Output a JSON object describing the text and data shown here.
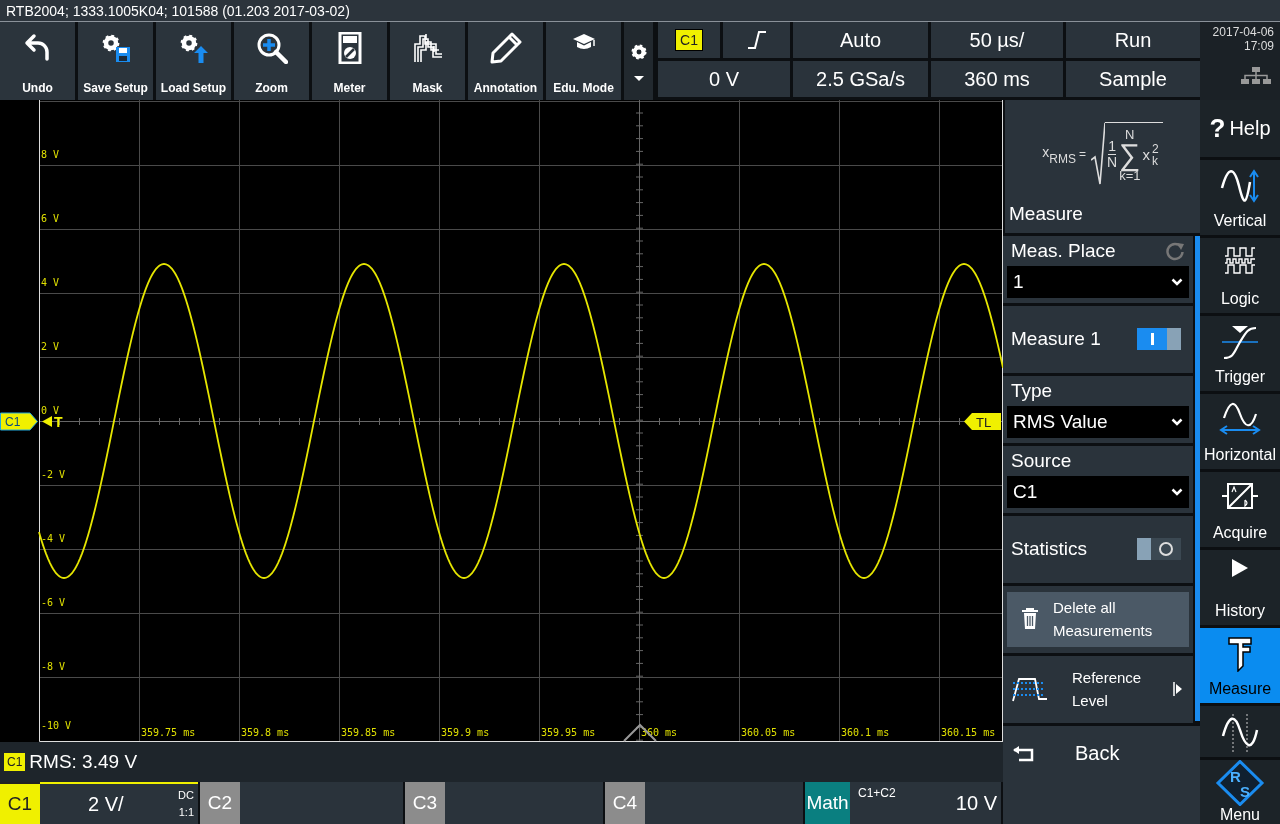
{
  "title_bar": {
    "text": "RTB2004; 1333.1005K04; 101588 (01.203 2017-03-02)"
  },
  "toolbar": {
    "buttons": [
      {
        "kind": "undo",
        "label": "Undo"
      },
      {
        "kind": "save",
        "label": "Save Setup"
      },
      {
        "kind": "load",
        "label": "Load Setup"
      },
      {
        "kind": "zoom",
        "label": "Zoom"
      },
      {
        "kind": "meter",
        "label": "Meter"
      },
      {
        "kind": "mask",
        "label": "Mask"
      },
      {
        "kind": "annotation",
        "label": "Annotation"
      },
      {
        "kind": "edu",
        "label": "Edu. Mode"
      }
    ]
  },
  "acquisition": {
    "trigger_source": "C1",
    "trigger_mode": "Auto",
    "time_scale": "50 µs/",
    "run_state": "Run",
    "trigger_level": "0 V",
    "sample_rate": "2.5 GSa/s",
    "time_position": "360 ms",
    "acquisition_mode": "Sample"
  },
  "clock": {
    "date": "2017-04-06",
    "time": "17:09"
  },
  "display": {
    "y_labels": [
      "8 V",
      "6 V",
      "4 V",
      "2 V",
      "0 V",
      "-2 V",
      "-4 V",
      "-6 V",
      "-8 V",
      "-10 V"
    ],
    "x_labels": [
      "359.75 ms",
      "359.8 ms",
      "359.85 ms",
      "359.9 ms",
      "359.95 ms",
      "360 ms",
      "360.05 ms",
      "360.1 ms",
      "360.15 ms"
    ],
    "channel_marker": "C1",
    "trigger_marker": "T",
    "trigger_level_marker": "TL"
  },
  "measurement_readout": {
    "source": "C1",
    "text": "RMS: 3.49 V"
  },
  "channel_bar": [
    {
      "kind": "channel",
      "label": "C1",
      "selected": true,
      "scale": "2 V/",
      "coupling": "DC",
      "probe": "1:1"
    },
    {
      "kind": "channel",
      "label": "C2",
      "selected": false
    },
    {
      "kind": "channel",
      "label": "C3",
      "selected": false
    },
    {
      "kind": "channel",
      "label": "C4",
      "selected": false
    },
    {
      "kind": "math",
      "label": "Math",
      "source": "C1+C2",
      "scale": "10 V"
    }
  ],
  "side_panel": {
    "formula": {
      "lhs": "x",
      "lhs_sub": "RMS",
      "equals": "=",
      "numerator": "1",
      "denominator": "N",
      "sum_top": "N",
      "sum_sign": "∑",
      "sum_bottom": "k=1",
      "term": "x",
      "term_sup": "2",
      "term_sub": "k"
    },
    "title": "Measure",
    "items": [
      {
        "kind": "dropdown",
        "label": "Meas. Place",
        "value": "1",
        "reset": true
      },
      {
        "kind": "toggle",
        "label": "Measure 1",
        "on": true
      },
      {
        "kind": "dropdown",
        "label": "Type",
        "value": "RMS Value",
        "reset": false
      },
      {
        "kind": "dropdown",
        "label": "Source",
        "value": "C1",
        "reset": false
      },
      {
        "kind": "toggle",
        "label": "Statistics",
        "on": false
      },
      {
        "kind": "button",
        "label": "Delete all Measurements"
      },
      {
        "kind": "submenu",
        "label": "Reference Level"
      }
    ],
    "back": {
      "label": "Back"
    }
  },
  "nav": [
    {
      "kind": "help",
      "symbol": "?",
      "label": "Help",
      "selected": false
    },
    {
      "kind": "vertical",
      "label": "Vertical",
      "selected": false
    },
    {
      "kind": "logic",
      "label": "Logic",
      "selected": false
    },
    {
      "kind": "trigger",
      "label": "Trigger",
      "selected": false
    },
    {
      "kind": "horizontal",
      "label": "Horizontal",
      "selected": false
    },
    {
      "kind": "acquire",
      "label": "Acquire",
      "selected": false
    },
    {
      "kind": "history",
      "label": "History",
      "selected": false
    },
    {
      "kind": "measure",
      "label": "Measure",
      "selected": true
    },
    {
      "kind": "math",
      "selected": false
    },
    {
      "kind": "logo",
      "letters": [
        "R",
        "S"
      ],
      "label": "Menu",
      "selected": false
    }
  ]
}
